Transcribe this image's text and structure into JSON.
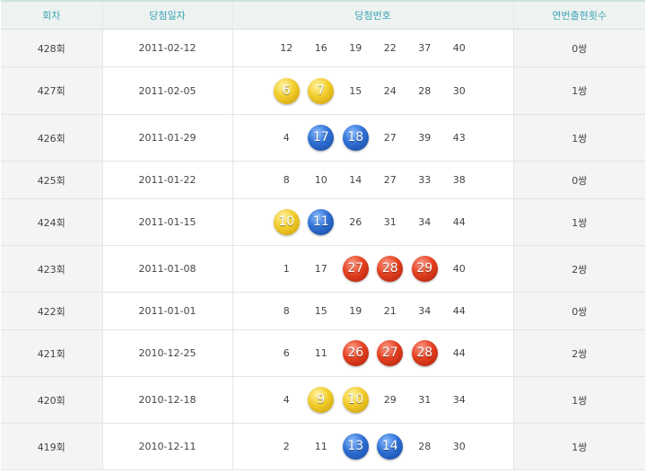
{
  "headers": {
    "round": "회차",
    "date": "당첨일자",
    "numbers": "당첨번호",
    "consecutive": "연번출현횟수"
  },
  "colors": {
    "header_text": "#3ba3b4",
    "yellow_ball": "#f2cc2a",
    "blue_ball": "#2f70d4",
    "red_ball": "#e4401f"
  },
  "rows": [
    {
      "round": "428회",
      "date": "2011-02-12",
      "numbers": [
        "12",
        "16",
        "19",
        "22",
        "37",
        "40"
      ],
      "count": "0쌍"
    },
    {
      "round": "427회",
      "date": "2011-02-05",
      "numbers": [
        "6",
        "7",
        "15",
        "24",
        "28",
        "30"
      ],
      "count": "1쌍"
    },
    {
      "round": "426회",
      "date": "2011-01-29",
      "numbers": [
        "4",
        "17",
        "18",
        "27",
        "39",
        "43"
      ],
      "count": "1쌍"
    },
    {
      "round": "425회",
      "date": "2011-01-22",
      "numbers": [
        "8",
        "10",
        "14",
        "27",
        "33",
        "38"
      ],
      "count": "0쌍"
    },
    {
      "round": "424회",
      "date": "2011-01-15",
      "numbers": [
        "10",
        "11",
        "26",
        "31",
        "34",
        "44"
      ],
      "count": "1쌍"
    },
    {
      "round": "423회",
      "date": "2011-01-08",
      "numbers": [
        "1",
        "17",
        "27",
        "28",
        "29",
        "40"
      ],
      "count": "2쌍"
    },
    {
      "round": "422회",
      "date": "2011-01-01",
      "numbers": [
        "8",
        "15",
        "19",
        "21",
        "34",
        "44"
      ],
      "count": "0쌍"
    },
    {
      "round": "421회",
      "date": "2010-12-25",
      "numbers": [
        "6",
        "11",
        "26",
        "27",
        "28",
        "44"
      ],
      "count": "2쌍"
    },
    {
      "round": "420회",
      "date": "2010-12-18",
      "numbers": [
        "4",
        "9",
        "10",
        "29",
        "31",
        "34"
      ],
      "count": "1쌍"
    },
    {
      "round": "419회",
      "date": "2010-12-11",
      "numbers": [
        "2",
        "11",
        "13",
        "14",
        "28",
        "30"
      ],
      "count": "1쌍"
    }
  ],
  "highlights": [
    [],
    [
      {
        "index": 0,
        "color": "yellow"
      },
      {
        "index": 1,
        "color": "yellow"
      }
    ],
    [
      {
        "index": 1,
        "color": "blue"
      },
      {
        "index": 2,
        "color": "blue"
      }
    ],
    [],
    [
      {
        "index": 0,
        "color": "yellow"
      },
      {
        "index": 1,
        "color": "blue"
      }
    ],
    [
      {
        "index": 2,
        "color": "red"
      },
      {
        "index": 3,
        "color": "red"
      },
      {
        "index": 4,
        "color": "red"
      }
    ],
    [],
    [
      {
        "index": 2,
        "color": "red"
      },
      {
        "index": 3,
        "color": "red"
      },
      {
        "index": 4,
        "color": "red"
      }
    ],
    [
      {
        "index": 1,
        "color": "yellow"
      },
      {
        "index": 2,
        "color": "yellow"
      }
    ],
    [
      {
        "index": 2,
        "color": "blue"
      },
      {
        "index": 3,
        "color": "blue"
      }
    ]
  ]
}
